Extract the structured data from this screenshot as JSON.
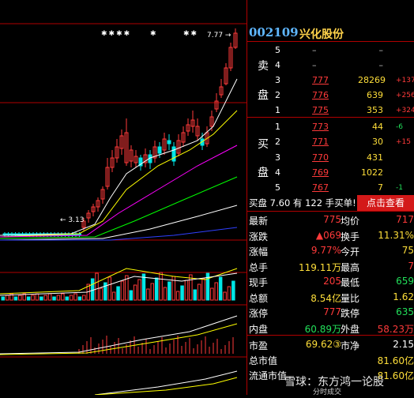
{
  "stock": {
    "code": "002109",
    "name": "兴化股份"
  },
  "chart": {
    "markers": [
      "✱✱✱✱",
      "✱",
      "✱✱"
    ],
    "high_label": "7.77",
    "low_label": "3.13"
  },
  "orderbook": {
    "sell_label": [
      "卖",
      "盘"
    ],
    "buy_label": [
      "买",
      "盘"
    ],
    "sell": [
      {
        "level": "5",
        "price": "–",
        "volume": "–",
        "change": ""
      },
      {
        "level": "4",
        "price": "–",
        "volume": "–",
        "change": ""
      },
      {
        "level": "3",
        "price": "777",
        "volume": "28269",
        "change": "+137"
      },
      {
        "level": "2",
        "price": "776",
        "volume": "639",
        "change": "+256"
      },
      {
        "level": "1",
        "price": "775",
        "volume": "353",
        "change": "+324"
      }
    ],
    "buy": [
      {
        "level": "1",
        "price": "773",
        "volume": "44",
        "change": "-6"
      },
      {
        "level": "2",
        "price": "771",
        "volume": "30",
        "change": "+15"
      },
      {
        "level": "3",
        "price": "770",
        "volume": "431",
        "change": ""
      },
      {
        "level": "4",
        "price": "769",
        "volume": "1022",
        "change": ""
      },
      {
        "level": "5",
        "price": "767",
        "volume": "7",
        "change": "-1"
      }
    ]
  },
  "trade_banner": {
    "text": "买盘 7.60 有 122 手买单!",
    "button": "点击查看"
  },
  "quote": [
    {
      "l1": "最新",
      "v1": "775",
      "l2": "均价",
      "v2": "717"
    },
    {
      "l1": "涨跌",
      "v1": "▲069",
      "l2": "换手",
      "v2": "11.31%"
    },
    {
      "l1": "涨幅",
      "v1": "9.77%",
      "l2": "今开",
      "v2": "75"
    },
    {
      "l1": "总手",
      "v1": "119.11万",
      "l2": "最高",
      "v2": "7"
    },
    {
      "l1": "现手",
      "v1": "205",
      "l2": "最低",
      "v2": "659"
    },
    {
      "l1": "总额",
      "v1": "8.54亿",
      "l2": "量比",
      "v2": "1.62"
    },
    {
      "l1": "涨停",
      "v1": "777",
      "l2": "跌停",
      "v2": "635"
    },
    {
      "l1": "内盘",
      "v1": "60.89万",
      "l2": "外盘",
      "v2": "58.23万"
    }
  ],
  "fundamentals": [
    {
      "l1": "市盈",
      "v1": "69.62③",
      "l2": "市净",
      "v2": "2.15"
    },
    {
      "l1": "总市值",
      "v1": "81.60亿"
    },
    {
      "l1": "流通市值",
      "v1": "81.60亿"
    }
  ],
  "watermark": {
    "main": "雪球：东方鸿一论股",
    "sub": "分时成交"
  },
  "colors": {
    "up": "#ff3a3a",
    "down": "#22e05a",
    "accent": "#ffdf3a",
    "grid": "#b00000",
    "ma5": "#ffffff",
    "ma10": "#ffff00",
    "ma20": "#ff00ff",
    "ma30": "#00ff00",
    "ma60": "#ffffff",
    "ma120": "#3040ff"
  }
}
